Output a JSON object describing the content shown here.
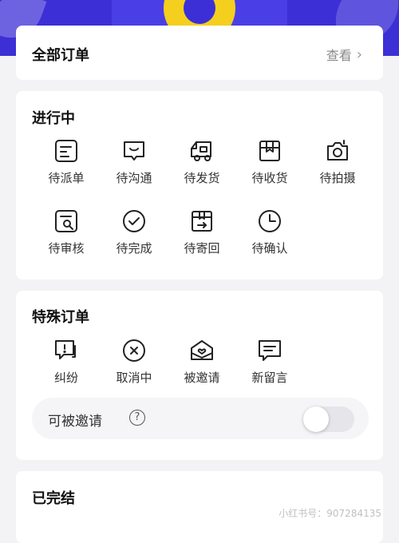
{
  "all_orders": {
    "title": "全部订单",
    "view": "查看"
  },
  "in_progress": {
    "title": "进行中",
    "items": [
      {
        "label": "待派单",
        "icon": "dispatch-icon"
      },
      {
        "label": "待沟通",
        "icon": "chat-icon"
      },
      {
        "label": "待发货",
        "icon": "truck-icon"
      },
      {
        "label": "待收货",
        "icon": "box-icon"
      },
      {
        "label": "待拍摄",
        "icon": "camera-icon"
      },
      {
        "label": "待审核",
        "icon": "review-icon"
      },
      {
        "label": "待完成",
        "icon": "check-circle-icon"
      },
      {
        "label": "待寄回",
        "icon": "return-box-icon"
      },
      {
        "label": "待确认",
        "icon": "clock-icon"
      }
    ]
  },
  "special": {
    "title": "特殊订单",
    "items": [
      {
        "label": "纠纷",
        "icon": "dispute-icon"
      },
      {
        "label": "取消中",
        "icon": "cancel-circle-icon"
      },
      {
        "label": "被邀请",
        "icon": "invite-mail-icon"
      },
      {
        "label": "新留言",
        "icon": "message-icon"
      }
    ],
    "invite_toggle": {
      "label": "可被邀请",
      "help": "?",
      "enabled": false
    }
  },
  "completed": {
    "title": "已完结"
  },
  "watermark": "小红书号：907284135"
}
